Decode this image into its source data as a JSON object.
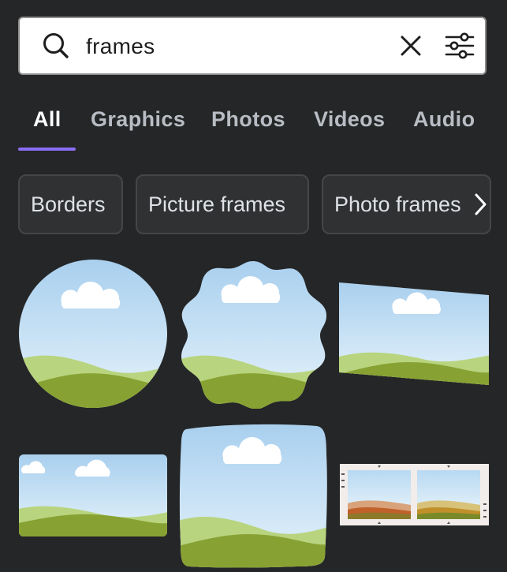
{
  "search": {
    "query": "frames",
    "icons": [
      "search-icon",
      "close-icon",
      "filter-icon"
    ]
  },
  "tabs": [
    {
      "label": "All",
      "active": true
    },
    {
      "label": "Graphics",
      "active": false
    },
    {
      "label": "Photos",
      "active": false
    },
    {
      "label": "Videos",
      "active": false
    },
    {
      "label": "Audio",
      "active": false
    }
  ],
  "chips": [
    {
      "label": "Borders"
    },
    {
      "label": "Picture frames"
    },
    {
      "label": "Photo frames"
    }
  ],
  "colors": {
    "background": "#252627",
    "accent": "#8b6cf6",
    "sky_top": "#a8cfee",
    "sky_bottom": "#e6f3fb",
    "hill_light": "#b8d47e",
    "hill_dark": "#87a233"
  },
  "results": [
    {
      "shape": "circle-frame"
    },
    {
      "shape": "scalloped-frame"
    },
    {
      "shape": "skewed-frame"
    },
    {
      "shape": "rounded-rect-frame"
    },
    {
      "shape": "rough-square-frame"
    },
    {
      "shape": "film-strip-frame"
    }
  ]
}
